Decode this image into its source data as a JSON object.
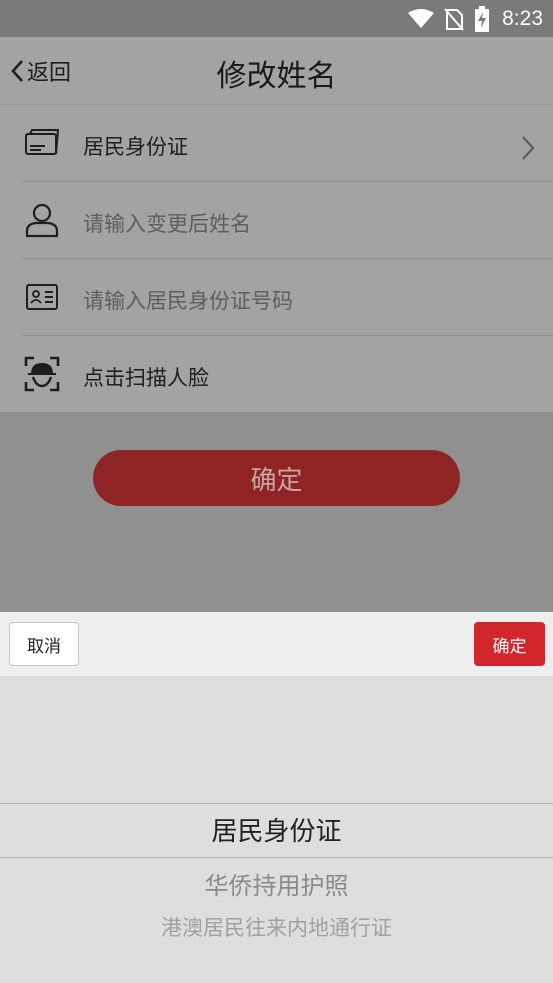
{
  "status_bar": {
    "time": "8:23",
    "icons": [
      "wifi-icon",
      "no-sim-icon",
      "battery-charging-icon"
    ]
  },
  "nav": {
    "back_label": "返回",
    "title": "修改姓名"
  },
  "form": {
    "rows": [
      {
        "icon": "id-card-icon",
        "text": "居民身份证",
        "has_chevron": true
      },
      {
        "icon": "person-icon",
        "placeholder": "请输入变更后姓名"
      },
      {
        "icon": "id-number-icon",
        "placeholder": "请输入居民身份证号码"
      },
      {
        "icon": "face-scan-icon",
        "text": "点击扫描人脸"
      }
    ]
  },
  "confirm_button": "确定",
  "picker": {
    "cancel_label": "取消",
    "ok_label": "确定",
    "options": [
      "居民身份证",
      "华侨持用护照",
      "港澳居民往来内地通行证"
    ],
    "selected_index": 0
  },
  "colors": {
    "accent_red": "#d0262c",
    "dimmed_red": "#8f2425"
  }
}
